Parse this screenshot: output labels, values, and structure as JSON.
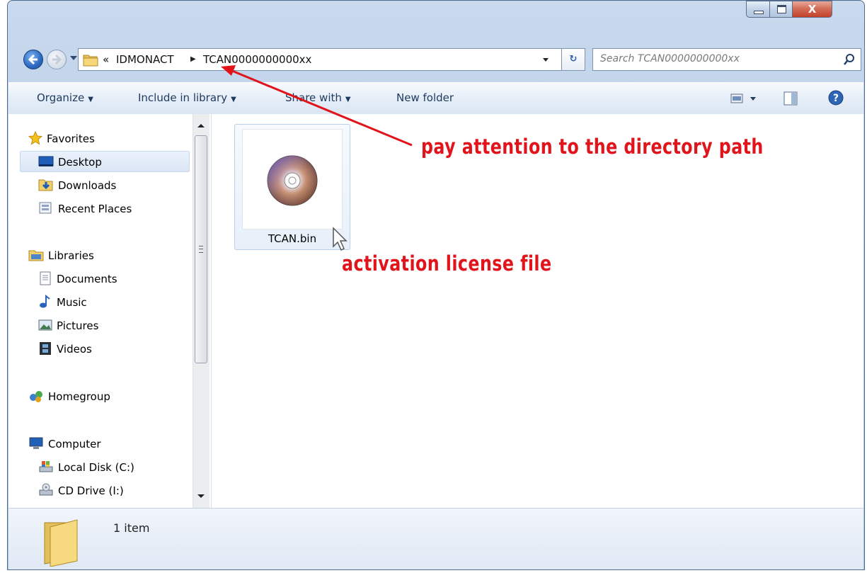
{
  "window": {
    "controls": {
      "close_label": "X"
    }
  },
  "address": {
    "overflow_glyph": "«",
    "crumbs": [
      "IDMONACT",
      "TCAN0000000000xx"
    ],
    "separator_glyph": "▶"
  },
  "search": {
    "placeholder": "Search TCAN0000000000xx"
  },
  "toolbar": {
    "organize": "Organize",
    "include_in_library": "Include in library",
    "share_with": "Share with",
    "new_folder": "New folder"
  },
  "nav": {
    "favorites": {
      "label": "Favorites",
      "items": [
        "Desktop",
        "Downloads",
        "Recent Places"
      ]
    },
    "libraries": {
      "label": "Libraries",
      "items": [
        "Documents",
        "Music",
        "Pictures",
        "Videos"
      ]
    },
    "homegroup": {
      "label": "Homegroup"
    },
    "computer": {
      "label": "Computer",
      "items": [
        "Local Disk (C:)",
        "CD Drive (I:)"
      ]
    },
    "selected": "Desktop"
  },
  "files": [
    {
      "name": "TCAN.bin",
      "icon": "disc-icon"
    }
  ],
  "status": {
    "item_count": "1 item"
  },
  "annotations": {
    "path_note": "pay attention to the directory path",
    "file_note": "activation license file",
    "color": "#e1141b"
  }
}
